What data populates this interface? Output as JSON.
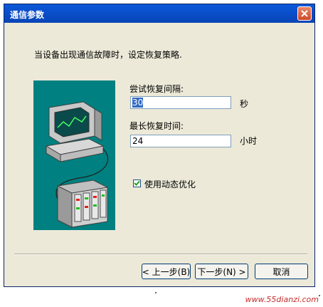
{
  "window": {
    "title": "通信参数"
  },
  "icons": {
    "close": "close-icon",
    "checkbox_mark": "checkmark-icon",
    "illustration": "computer-network-illustration"
  },
  "instruction": "当设备出现通信故障时，设定恢复策略.",
  "retry_interval": {
    "label": "尝试恢复间隔:",
    "value": "30",
    "unit": "秒"
  },
  "max_recovery": {
    "label": "最长恢复时间:",
    "value": "24",
    "unit": "小时"
  },
  "dynamic_optimization": {
    "label": "使用动态优化",
    "checked": true
  },
  "buttons": {
    "back": "< 上一步(B)",
    "next": "下一步(N) >",
    "cancel": "取消"
  },
  "watermark": "www.55dianzi.com",
  "colors": {
    "title_bar": "#0a4fcc",
    "dialog_bg": "#ece9d8",
    "illustration_bg": "#008080",
    "watermark": "#c62a2a"
  }
}
